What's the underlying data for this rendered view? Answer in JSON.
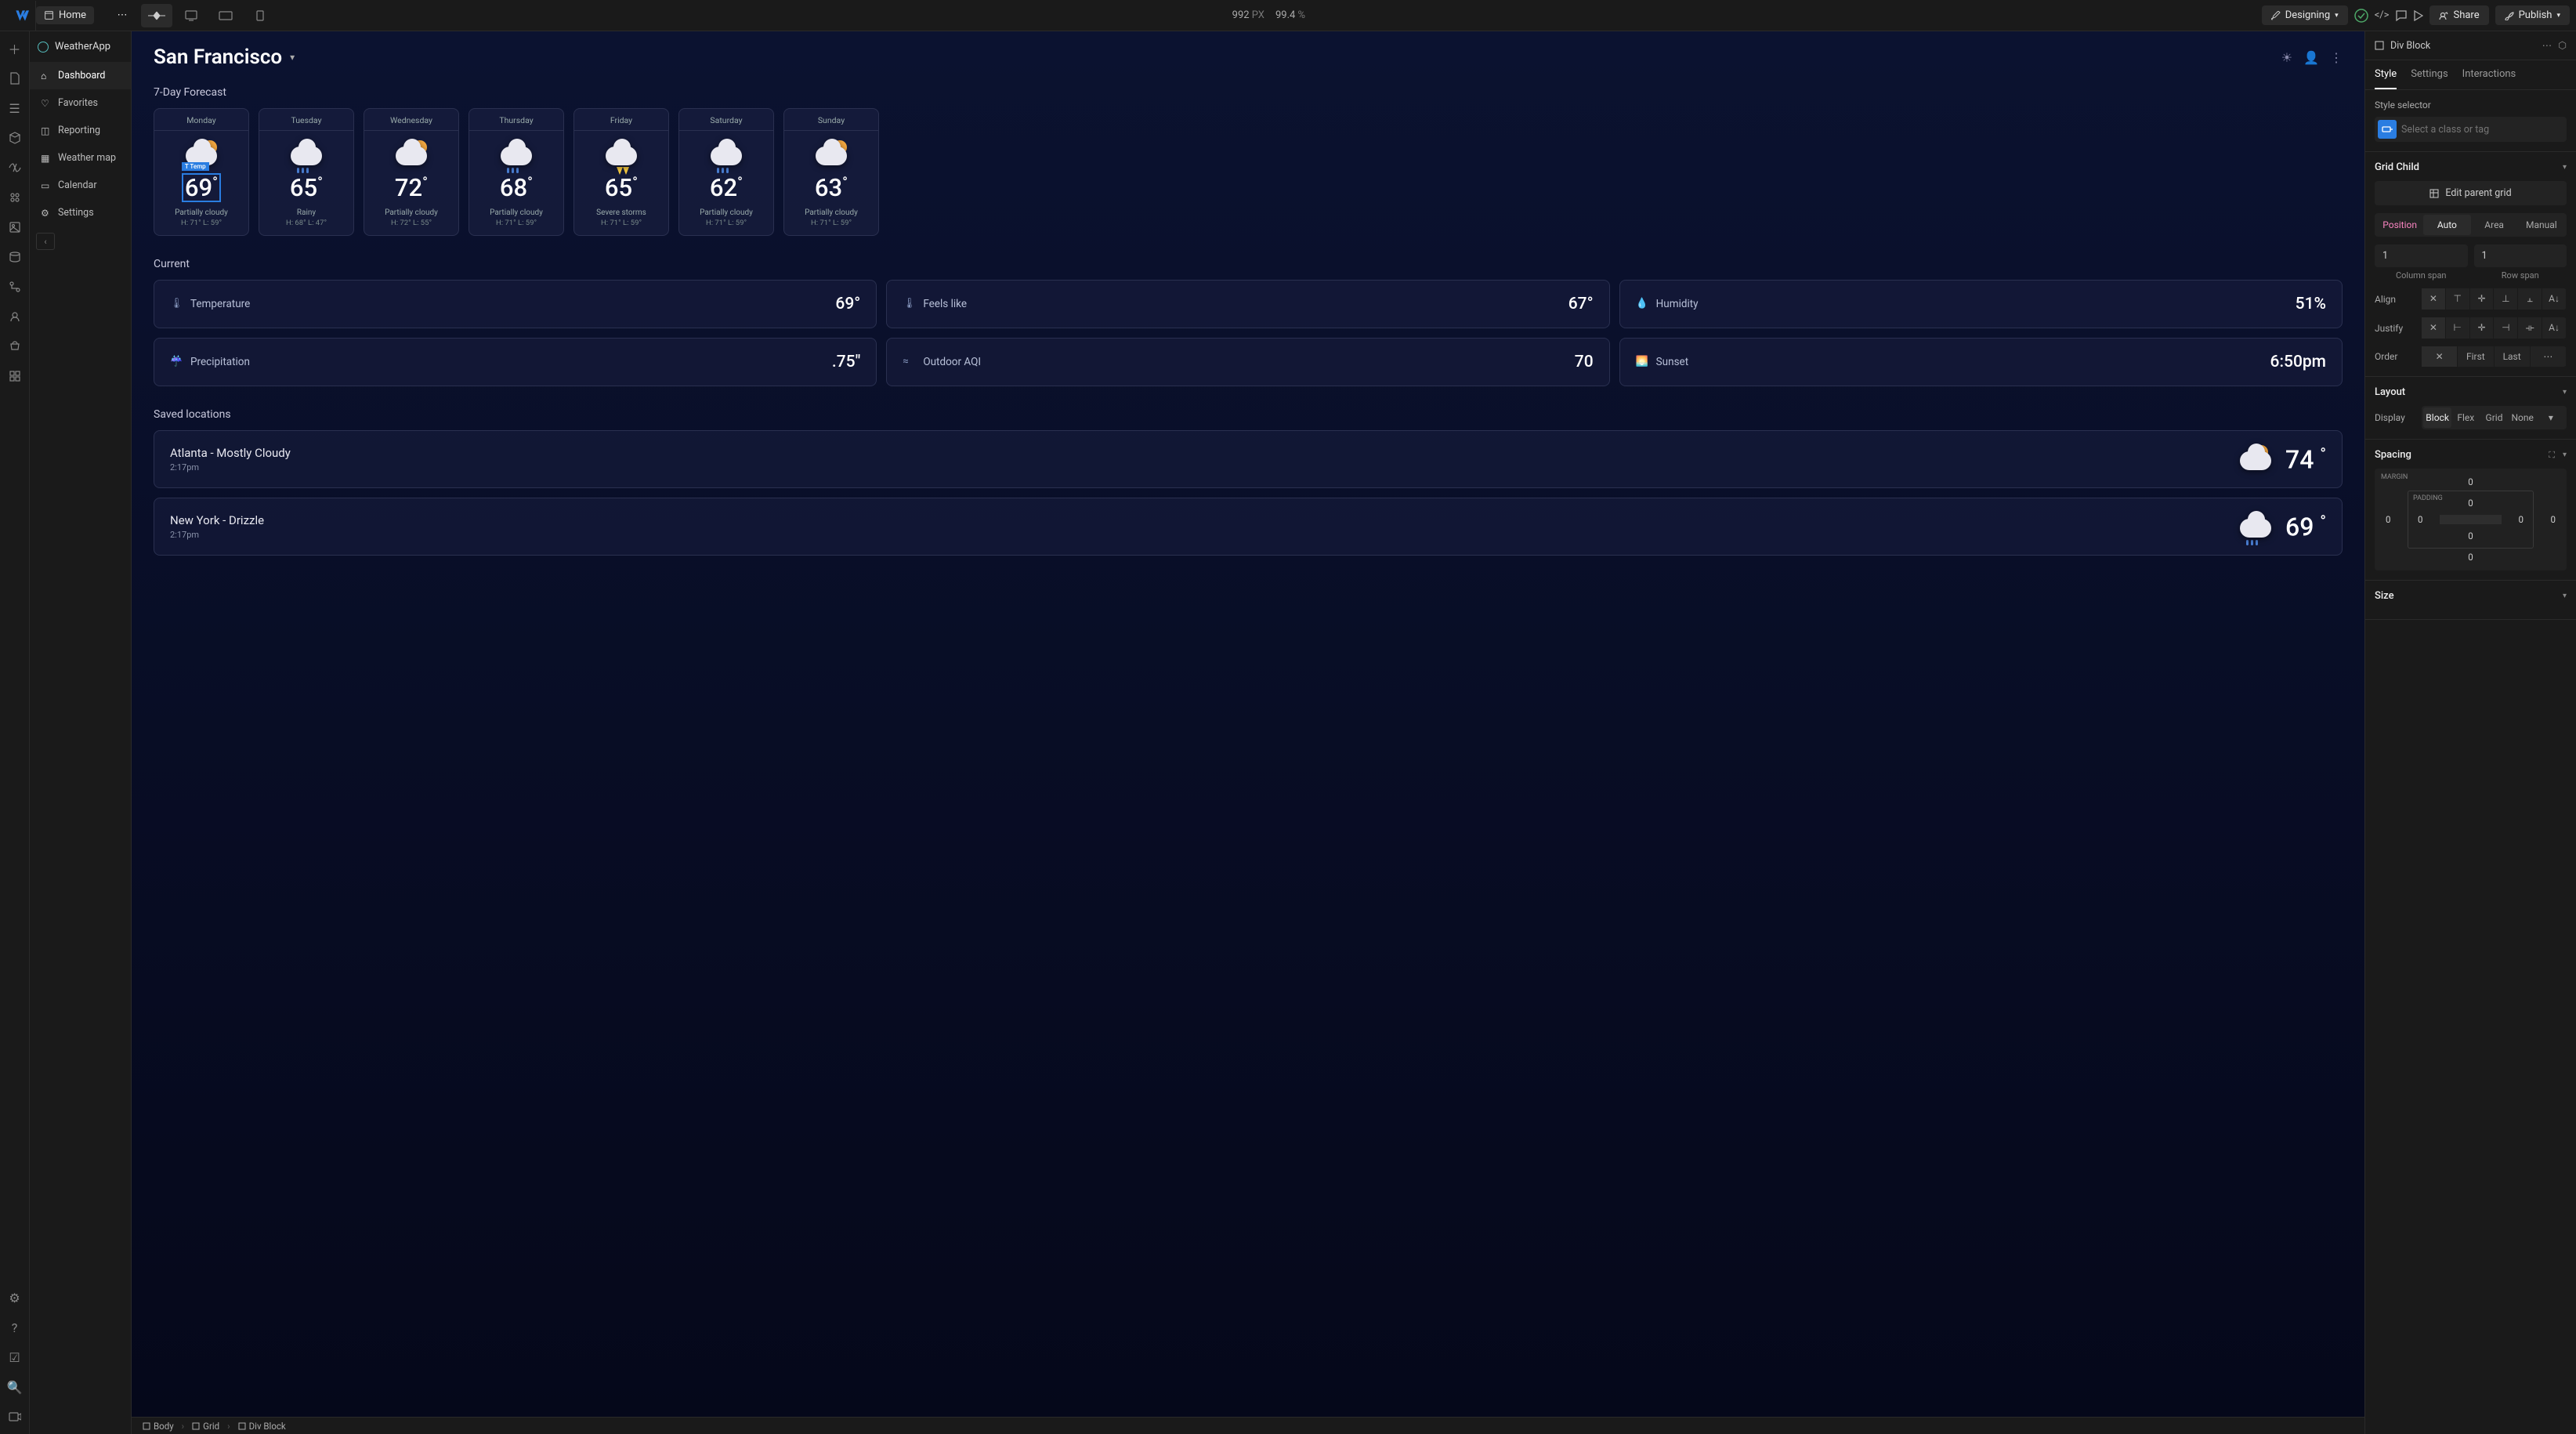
{
  "topbar": {
    "home": "Home",
    "px_value": "992",
    "px_unit": "PX",
    "zoom": "99.4",
    "zoom_unit": "%",
    "mode": "Designing",
    "share": "Share",
    "publish": "Publish"
  },
  "sidebar": {
    "app_name": "WeatherApp",
    "items": [
      {
        "label": "Dashboard"
      },
      {
        "label": "Favorites"
      },
      {
        "label": "Reporting"
      },
      {
        "label": "Weather map"
      },
      {
        "label": "Calendar"
      },
      {
        "label": "Settings"
      }
    ]
  },
  "canvas": {
    "location": "San Francisco",
    "forecast_title": "7-Day Forecast",
    "days": [
      {
        "name": "Monday",
        "temp": "69",
        "cond": "Partially cloudy",
        "hl": "H: 71°   L: 59°",
        "kind": "pc"
      },
      {
        "name": "Tuesday",
        "temp": "65",
        "cond": "Rainy",
        "hl": "H: 68°   L: 47°",
        "kind": "rain"
      },
      {
        "name": "Wednesday",
        "temp": "72",
        "cond": "Partially cloudy",
        "hl": "H: 72°   L: 55°",
        "kind": "pc"
      },
      {
        "name": "Thursday",
        "temp": "68",
        "cond": "Partially cloudy",
        "hl": "H: 71°   L: 59°",
        "kind": "rain"
      },
      {
        "name": "Friday",
        "temp": "65",
        "cond": "Severe storms",
        "hl": "H: 71°   L: 59°",
        "kind": "storm"
      },
      {
        "name": "Saturday",
        "temp": "62",
        "cond": "Partially cloudy",
        "hl": "H: 71°   L: 59°",
        "kind": "rain"
      },
      {
        "name": "Sunday",
        "temp": "63",
        "cond": "Partially cloudy",
        "hl": "H: 71°   L: 59°",
        "kind": "pc"
      }
    ],
    "sel_label": "T  Temp",
    "current_title": "Current",
    "current": [
      {
        "label": "Temperature",
        "value": "69°"
      },
      {
        "label": "Feels like",
        "value": "67°"
      },
      {
        "label": "Humidity",
        "value": "51%"
      },
      {
        "label": "Precipitation",
        "value": ".75\""
      },
      {
        "label": "Outdoor AQI",
        "value": "70"
      },
      {
        "label": "Sunset",
        "value": "6:50pm"
      }
    ],
    "saved_title": "Saved locations",
    "saved": [
      {
        "title": "Atlanta - Mostly Cloudy",
        "time": "2:17pm",
        "temp": "74"
      },
      {
        "title": "New York - Drizzle",
        "time": "2:17pm",
        "temp": "69"
      }
    ]
  },
  "inspector": {
    "element": "Div Block",
    "tabs": [
      "Style",
      "Settings",
      "Interactions"
    ],
    "style_selector_label": "Style selector",
    "selector_placeholder": "Select a class or tag",
    "grid_child": "Grid Child",
    "edit_parent": "Edit parent grid",
    "position_label": "Position",
    "position_opts": [
      "Auto",
      "Area",
      "Manual"
    ],
    "col_span": "1",
    "col_span_label": "Column span",
    "row_span": "1",
    "row_span_label": "Row span",
    "align_label": "Align",
    "justify_label": "Justify",
    "order_label": "Order",
    "order_first": "First",
    "order_last": "Last",
    "layout": "Layout",
    "display_label": "Display",
    "display_opts": [
      "Block",
      "Flex",
      "Grid",
      "None"
    ],
    "spacing": "Spacing",
    "margin_label": "MARGIN",
    "padding_label": "PADDING",
    "sp_top": "0",
    "sp_right": "0",
    "sp_bottom": "0",
    "sp_left": "0",
    "pd_top": "0",
    "pd_right": "0",
    "pd_bottom": "0",
    "pd_left": "0",
    "size": "Size"
  },
  "breadcrumb": [
    "Body",
    "Grid",
    "Div Block"
  ]
}
